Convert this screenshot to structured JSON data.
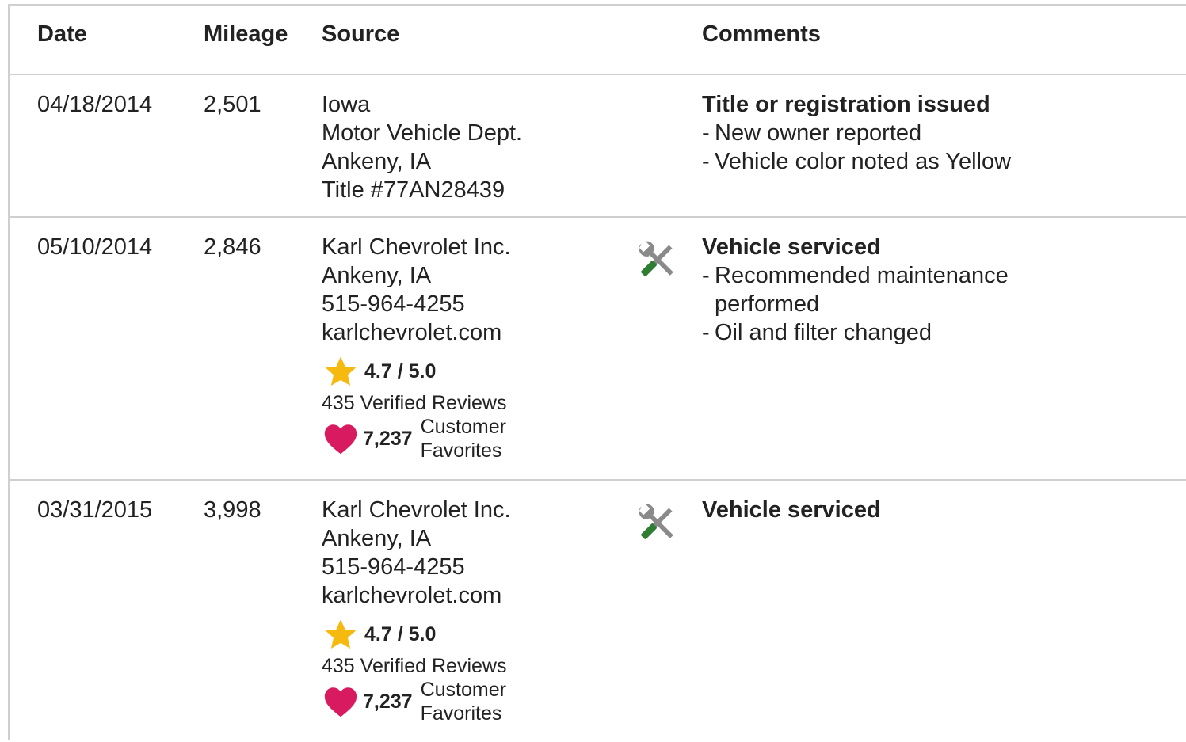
{
  "columns": {
    "date": "Date",
    "mileage": "Mileage",
    "source": "Source",
    "comments": "Comments"
  },
  "records": [
    {
      "date": "04/18/2014",
      "mileage": "2,501",
      "source": [
        "Iowa",
        "Motor Vehicle Dept.",
        "Ankeny, IA",
        "Title #77AN28439"
      ],
      "comment_title": "Title or registration issued",
      "comment_items": [
        "New owner reported",
        "Vehicle color noted as Yellow"
      ],
      "icon": null
    },
    {
      "date": "05/10/2014",
      "mileage": "2,846",
      "source": [
        "Karl Chevrolet Inc.",
        "Ankeny, IA",
        "515-964-4255",
        "karlchevrolet.com"
      ],
      "rating": "4.7 / 5.0",
      "reviews": "435 Verified Reviews",
      "favorites_count": "7,237",
      "favorites_label": [
        "Customer",
        "Favorites"
      ],
      "comment_title": "Vehicle serviced",
      "comment_items": [
        "Recommended maintenance performed",
        "Oil and filter changed"
      ],
      "icon": "service-tools-icon"
    },
    {
      "date": "03/31/2015",
      "mileage": "3,998",
      "source": [
        "Karl Chevrolet Inc.",
        "Ankeny, IA",
        "515-964-4255",
        "karlchevrolet.com"
      ],
      "rating": "4.7 / 5.0",
      "reviews": "435 Verified Reviews",
      "favorites_count": "7,237",
      "favorites_label": [
        "Customer",
        "Favorites"
      ],
      "comment_title": "Vehicle serviced",
      "comment_items": [],
      "icon": "service-tools-icon"
    }
  ],
  "colors": {
    "star": "#F5B90F",
    "heart": "#D81B60",
    "tool_gray": "#8A8A8A",
    "tool_green": "#2E7D32",
    "border": "#CFCFCF"
  }
}
